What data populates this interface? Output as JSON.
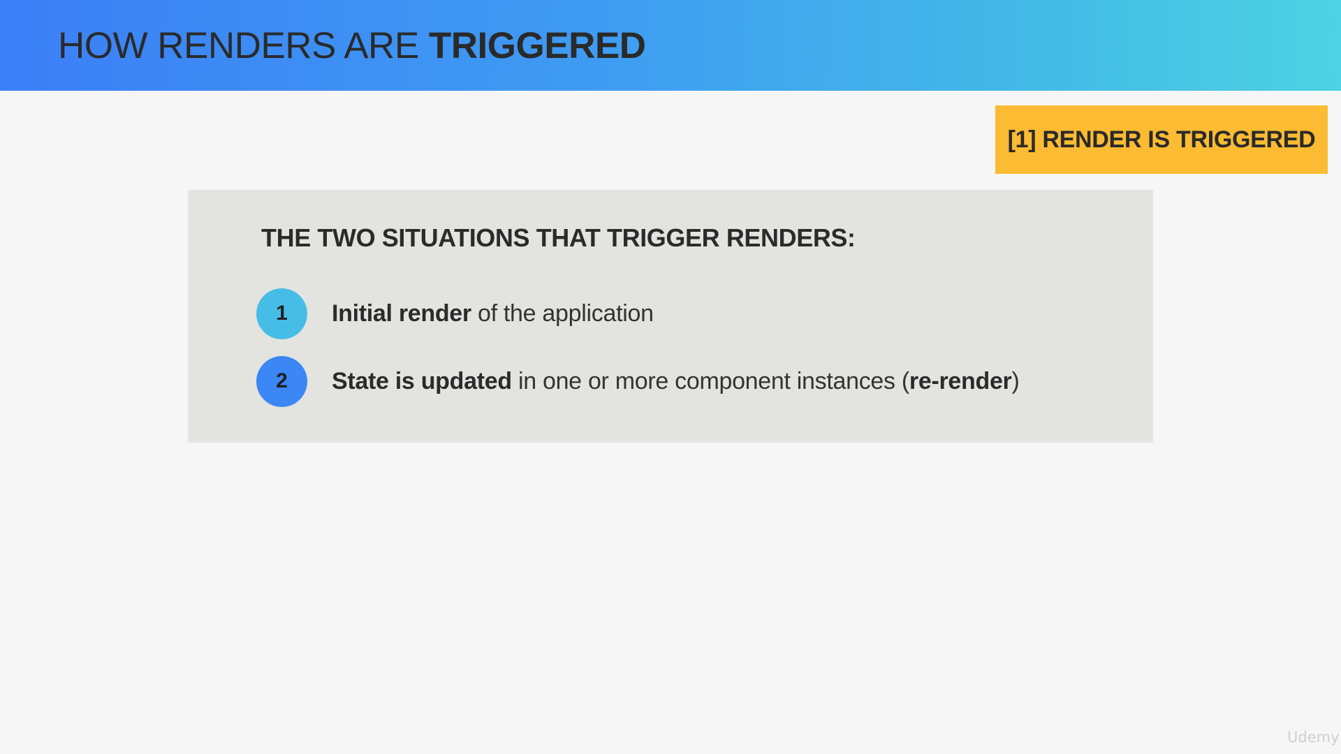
{
  "header": {
    "title_regular": "HOW RENDERS ARE ",
    "title_bold": "TRIGGERED"
  },
  "step_badge": {
    "label": "[1] RENDER IS TRIGGERED",
    "color": "#fbbb32"
  },
  "panel": {
    "heading": "THE TWO SITUATIONS THAT TRIGGER RENDERS:",
    "items": [
      {
        "number": "1",
        "bold": "Initial render",
        "rest": " of the application",
        "circle_color": "#46bde6"
      },
      {
        "number": "2",
        "bold": "State is updated",
        "rest": " in one or more component instances (",
        "bold_2": "re-render",
        "tail": ")",
        "circle_color": "#3a87f5"
      }
    ]
  },
  "watermark": {
    "text": "Udemy"
  }
}
